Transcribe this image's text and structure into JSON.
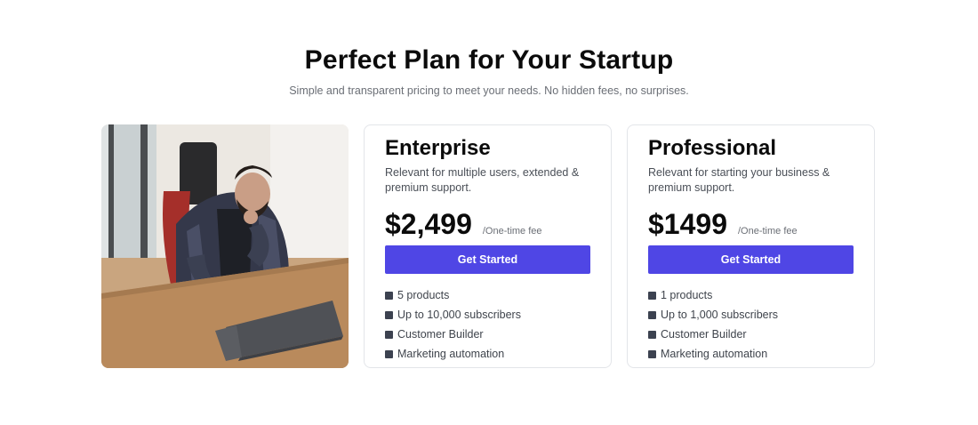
{
  "header": {
    "title": "Perfect Plan for Your Startup",
    "subtitle": "Simple and transparent pricing to meet your needs. No hidden fees, no surprises."
  },
  "hero_image": {
    "subject": "man-working-on-laptop"
  },
  "plans": [
    {
      "name": "Enterprise",
      "description": "Relevant for multiple users, extended & premium support.",
      "price": "$2,499",
      "fee_note": "/One-time fee",
      "cta_label": "Get Started",
      "features": [
        "5 products",
        "Up to 10,000 subscribers",
        "Customer Builder",
        "Marketing automation"
      ]
    },
    {
      "name": "Professional",
      "description": "Relevant for starting your business & premium support.",
      "price": "$1499",
      "fee_note": "/One-time fee",
      "cta_label": "Get Started",
      "features": [
        "1 products",
        "Up to 1,000 subscribers",
        "Customer Builder",
        "Marketing automation"
      ]
    }
  ],
  "colors": {
    "accent": "#4f46e5",
    "heading": "#0b0b0b",
    "muted": "#6b6f76",
    "card_border": "#e3e5e9",
    "bullet": "#3c4250"
  },
  "icons": {
    "feature_bullet": "square-bullet-icon"
  }
}
